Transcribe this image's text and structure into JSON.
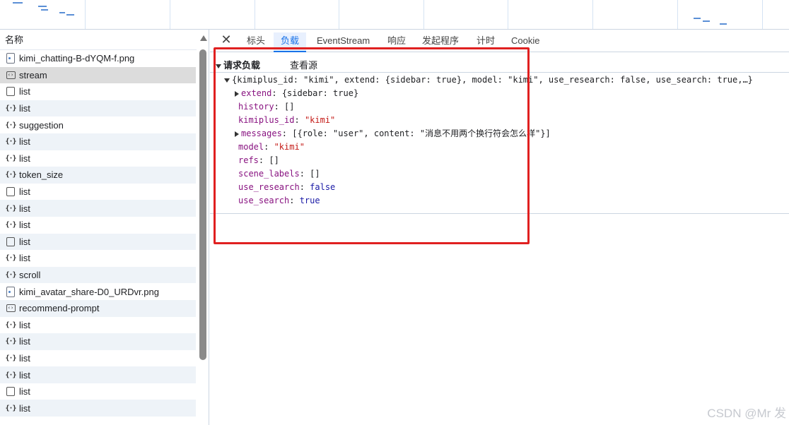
{
  "request_list": {
    "header": "名称",
    "items": [
      {
        "icon": "image-file-icon",
        "name": "kimi_chatting-B-dYQM-f.png"
      },
      {
        "icon": "code-icon",
        "name": "stream"
      },
      {
        "icon": "document-icon",
        "name": "list"
      },
      {
        "icon": "json-icon",
        "name": "list"
      },
      {
        "icon": "json-icon",
        "name": "suggestion"
      },
      {
        "icon": "json-icon",
        "name": "list"
      },
      {
        "icon": "json-icon",
        "name": "list"
      },
      {
        "icon": "json-icon",
        "name": "token_size"
      },
      {
        "icon": "document-icon",
        "name": "list"
      },
      {
        "icon": "json-icon",
        "name": "list"
      },
      {
        "icon": "json-icon",
        "name": "list"
      },
      {
        "icon": "document-icon",
        "name": "list"
      },
      {
        "icon": "json-icon",
        "name": "list"
      },
      {
        "icon": "json-icon",
        "name": "scroll"
      },
      {
        "icon": "image-file-icon",
        "name": "kimi_avatar_share-D0_URDvr.png"
      },
      {
        "icon": "code-icon",
        "name": "recommend-prompt"
      },
      {
        "icon": "json-icon",
        "name": "list"
      },
      {
        "icon": "json-icon",
        "name": "list"
      },
      {
        "icon": "json-icon",
        "name": "list"
      },
      {
        "icon": "json-icon",
        "name": "list"
      },
      {
        "icon": "document-icon",
        "name": "list"
      },
      {
        "icon": "json-icon",
        "name": "list"
      }
    ]
  },
  "detail_tabs": {
    "close_symbol": "✕",
    "tabs": [
      "标头",
      "负载",
      "EventStream",
      "响应",
      "发起程序",
      "计时",
      "Cookie"
    ],
    "active": "负载"
  },
  "payload": {
    "section_title": "请求负载",
    "view_source": "查看源",
    "summary": "{kimiplus_id: \"kimi\", extend: {sidebar: true}, model: \"kimi\", use_research: false, use_search: true,…}",
    "fields": [
      {
        "key": "extend",
        "sep": ": ",
        "value": "{sidebar: true}",
        "expandable": true
      },
      {
        "key": "history",
        "sep": ": ",
        "value": "[]",
        "expandable": false
      },
      {
        "key": "kimiplus_id",
        "sep": ": ",
        "value": "\"kimi\"",
        "expandable": false
      },
      {
        "key": "messages",
        "sep": ": ",
        "value": "[{role: \"user\", content: \"消息不用两个换行符会怎么样\"}]",
        "expandable": true
      },
      {
        "key": "model",
        "sep": ": ",
        "value": "\"kimi\"",
        "expandable": false
      },
      {
        "key": "refs",
        "sep": ": ",
        "value": "[]",
        "expandable": false
      },
      {
        "key": "scene_labels",
        "sep": ": ",
        "value": "[]",
        "expandable": false
      },
      {
        "key": "use_research",
        "sep": ": ",
        "value": "false",
        "expandable": false
      },
      {
        "key": "use_search",
        "sep": ": ",
        "value": "true",
        "expandable": false
      }
    ]
  },
  "watermark": "CSDN @Mr 发",
  "colors": {
    "highlight_box": "#e02020",
    "active_tab": "#1a73e8",
    "string_value": "#c41a16",
    "keyword_value": "#1a1aa6",
    "property_key": "#881280"
  }
}
